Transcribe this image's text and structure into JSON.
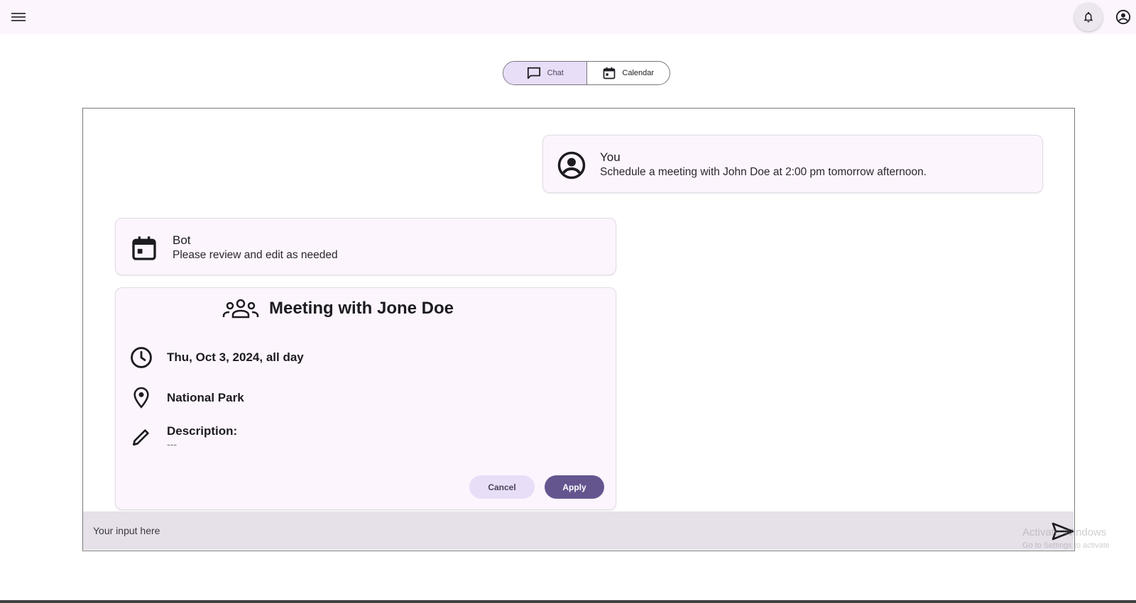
{
  "header": {
    "menu_icon": "menu-icon",
    "notifications_icon": "bell-icon",
    "account_icon": "account-circle-icon"
  },
  "view_toggle": {
    "options": [
      {
        "label": "Chat",
        "icon": "chat-bubble-icon",
        "selected": true
      },
      {
        "label": "Calendar",
        "icon": "calendar-icon",
        "selected": false
      }
    ]
  },
  "chat": {
    "messages": [
      {
        "sender": "You",
        "text": "Schedule a meeting with John Doe at 2:00 pm tomorrow afternoon.",
        "icon": "account-circle-icon"
      },
      {
        "sender": "Bot",
        "text": "Please review and edit as needed",
        "icon": "calendar-icon"
      }
    ],
    "event": {
      "title": "Meeting with Jone Doe",
      "title_icon": "groups-icon",
      "date": "Thu, Oct 3, 2024, all day",
      "location": "National Park",
      "description_label": "Description:",
      "description_value": "---",
      "cancel_label": "Cancel",
      "apply_label": "Apply"
    },
    "input": {
      "placeholder": "Your input here",
      "value": "",
      "send_icon": "send-icon"
    }
  },
  "watermark": {
    "line1": "Activate Windows",
    "line2": "Go to Settings to activate"
  },
  "colors": {
    "accent": "#65558f",
    "accent_container": "#e8def8",
    "surface": "#fdf5fd",
    "input_bar": "#e6e0e9"
  }
}
